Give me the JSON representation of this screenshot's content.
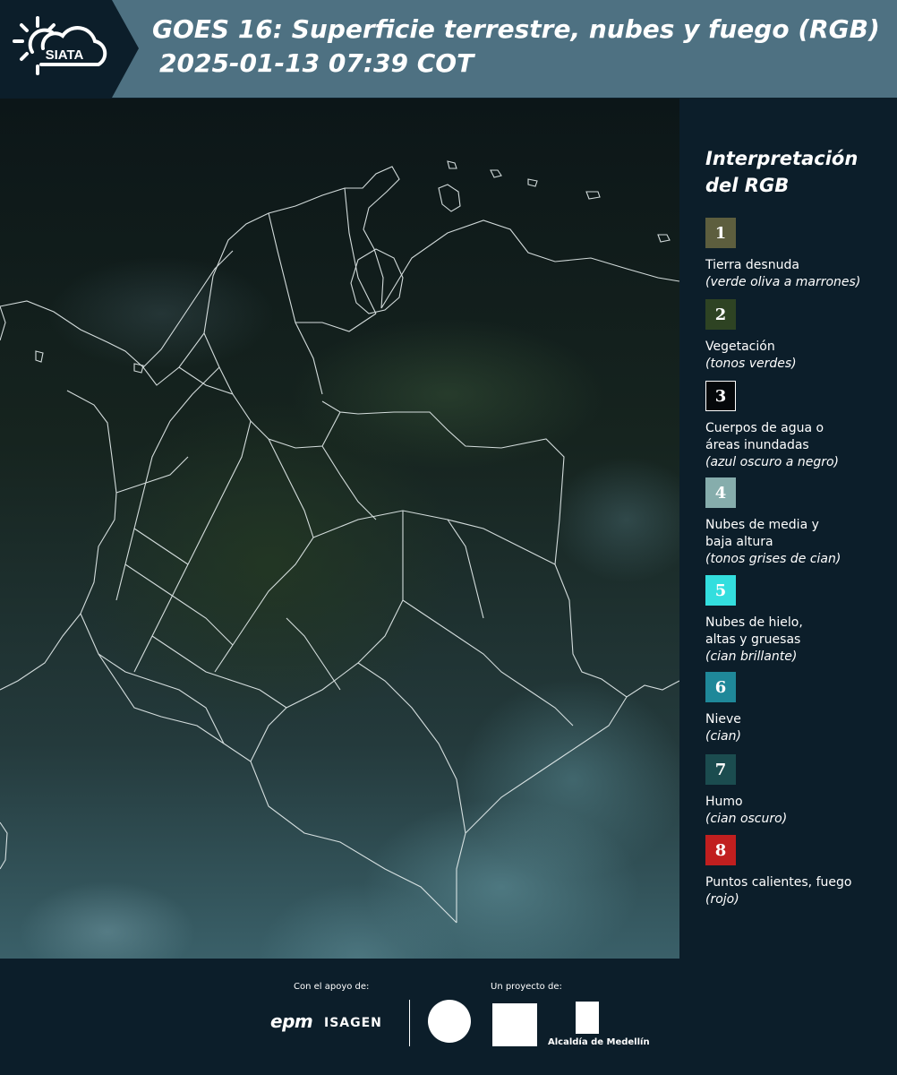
{
  "header": {
    "logo_text": "SIATA",
    "title_line1": "GOES 16: Superficie terrestre, nubes y fuego (RGB)",
    "title_line2": "2025-01-13 07:39 COT"
  },
  "legend": {
    "title_line1": "Interpretación",
    "title_line2": "del RGB",
    "items": [
      {
        "num": "1",
        "color": "#5d5e3e",
        "label": "Tierra desnuda",
        "sub": "(verde oliva a marrones)"
      },
      {
        "num": "2",
        "color": "#2e4323",
        "label": "Vegetación",
        "sub": "(tonos verdes)"
      },
      {
        "num": "3",
        "color": "#05080a",
        "label": "Cuerpos de agua o áreas inundadas",
        "sub": "(azul oscuro a negro)"
      },
      {
        "num": "4",
        "color": "#86adac",
        "label": "Nubes de media y baja altura",
        "sub": "(tonos grises de cian)"
      },
      {
        "num": "5",
        "color": "#33dede",
        "label": "Nubes de hielo, altas y gruesas",
        "sub": "(cian brillante)"
      },
      {
        "num": "6",
        "color": "#1f8899",
        "label": "Nieve",
        "sub": "(cian)"
      },
      {
        "num": "7",
        "color": "#1b4c4f",
        "label": "Humo",
        "sub": "(cian oscuro)"
      },
      {
        "num": "8",
        "color": "#c11f1f",
        "label": "Puntos calientes, fuego",
        "sub": "(rojo)"
      }
    ]
  },
  "footer": {
    "support_label": "Con el apoyo de:",
    "project_label": "Un proyecto de:",
    "sponsors": [
      "epm",
      "ISAGEN"
    ],
    "alcaldia_label": "Alcaldía de Medellín"
  }
}
